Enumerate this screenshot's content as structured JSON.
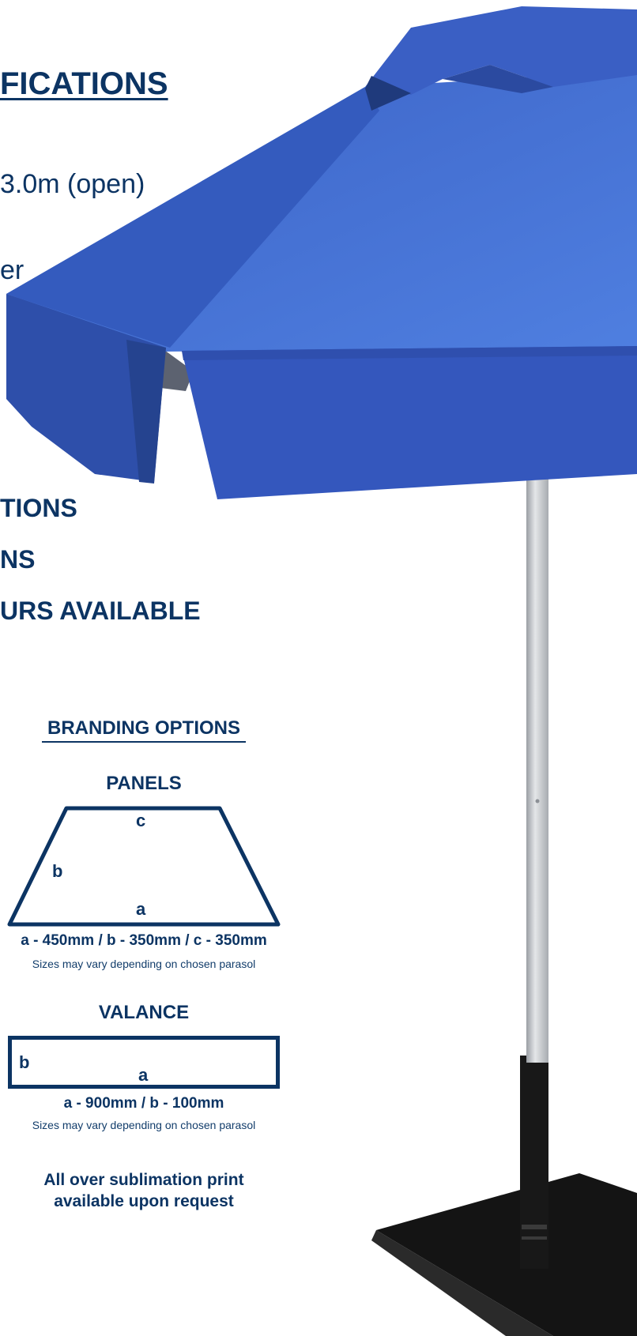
{
  "specifications": {
    "heading": "FICATIONS",
    "lines": [
      "3.0m (open)",
      "er"
    ]
  },
  "options": {
    "lines": [
      "TIONS",
      "NS",
      "URS AVAILABLE"
    ]
  },
  "branding": {
    "title": "BRANDING OPTIONS",
    "panels": {
      "title": "PANELS",
      "labels": {
        "a": "a",
        "b": "b",
        "c": "c"
      },
      "dimensions": "a - 450mm  /  b - 350mm  /  c - 350mm",
      "note": "Sizes may vary depending on chosen parasol"
    },
    "valance": {
      "title": "VALANCE",
      "labels": {
        "a": "a",
        "b": "b"
      },
      "dimensions": "a - 900mm  /  b - 100mm",
      "note": "Sizes may vary depending on chosen parasol"
    },
    "sublimation": [
      "All over sublimation print",
      "available upon request"
    ]
  },
  "colors": {
    "navy": "#0c3463",
    "canopy": "#3a62c8",
    "pole": "#c9ccd0",
    "base": "#1a1a1a"
  }
}
